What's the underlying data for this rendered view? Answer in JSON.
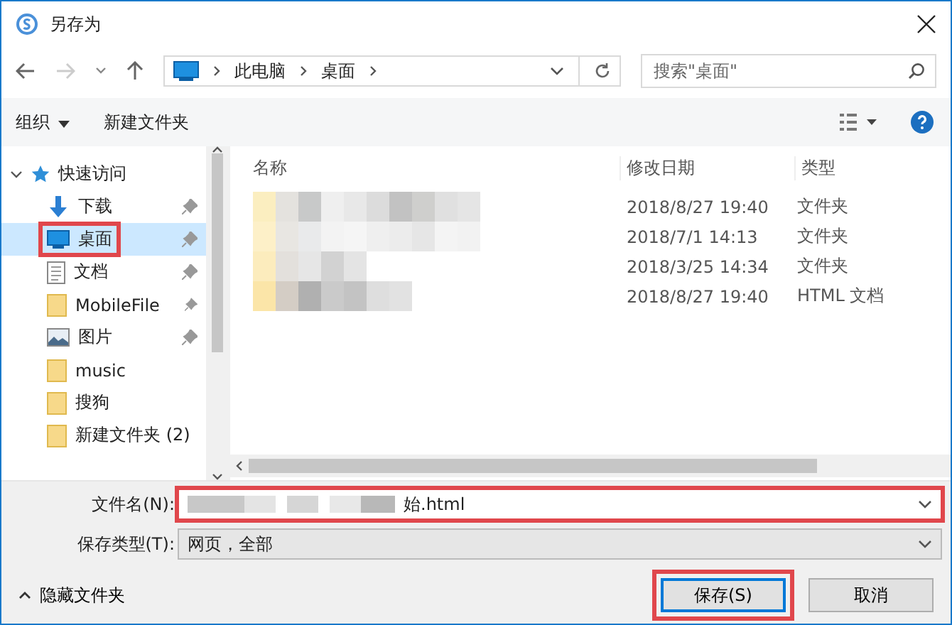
{
  "window": {
    "title": "另存为"
  },
  "address": {
    "path": [
      "此电脑",
      "桌面"
    ],
    "search_placeholder": "搜索\"桌面\""
  },
  "toolbar": {
    "organize": "组织",
    "new_folder": "新建文件夹"
  },
  "nav": {
    "label": "快速访问",
    "expanded": true,
    "children": [
      {
        "label": "下载",
        "kind": "download",
        "pinned": true,
        "selected": false,
        "highlighted": false
      },
      {
        "label": "桌面",
        "kind": "desktop",
        "pinned": true,
        "selected": true,
        "highlighted": true
      },
      {
        "label": "文档",
        "kind": "document",
        "pinned": true,
        "selected": false,
        "highlighted": false
      },
      {
        "label": "MobileFile",
        "kind": "folder",
        "pinned": true,
        "selected": false,
        "highlighted": false
      },
      {
        "label": "图片",
        "kind": "picture",
        "pinned": true,
        "selected": false,
        "highlighted": false
      },
      {
        "label": "music",
        "kind": "folder",
        "pinned": false,
        "selected": false,
        "highlighted": false
      },
      {
        "label": "搜狗",
        "kind": "folder",
        "pinned": false,
        "selected": false,
        "highlighted": false
      },
      {
        "label": "新建文件夹 (2)",
        "kind": "folder",
        "pinned": false,
        "selected": false,
        "highlighted": false
      }
    ]
  },
  "files": {
    "columns": [
      "名称",
      "修改日期",
      "类型"
    ],
    "rows": [
      {
        "date": "2018/8/27 19:40",
        "type": "文件夹"
      },
      {
        "date": "2018/7/1 14:13",
        "type": "文件夹"
      },
      {
        "date": "2018/3/25 14:34",
        "type": "文件夹"
      },
      {
        "date": "2018/8/27 19:40",
        "type": "HTML 文档"
      }
    ]
  },
  "filename": {
    "label": "文件名(N):",
    "value": "始.html",
    "highlighted": true
  },
  "filetype": {
    "label": "保存类型(T):",
    "value": "网页，全部"
  },
  "footer": {
    "toggle": "隐藏文件夹",
    "buttons": [
      {
        "label": "保存(S)",
        "primary": true,
        "highlighted": true
      },
      {
        "label": "取消",
        "primary": false,
        "highlighted": false
      }
    ]
  }
}
